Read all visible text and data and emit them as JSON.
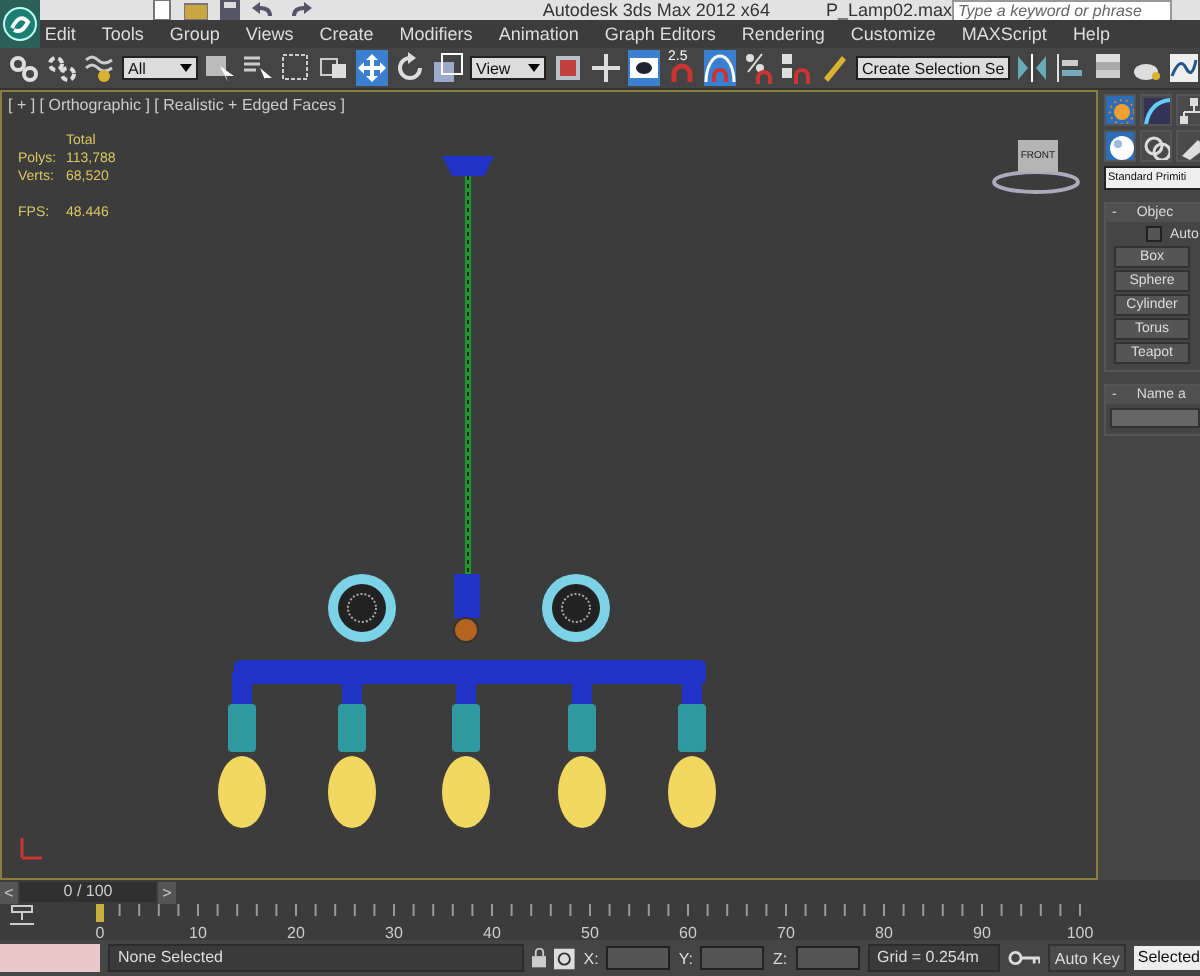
{
  "title_bar": {
    "title": "Autodesk 3ds Max  2012 x64",
    "file": "P_Lamp02.max",
    "search": {
      "placeholder": "Type a keyword or phrase"
    }
  },
  "menu": [
    "Edit",
    "Tools",
    "Group",
    "Views",
    "Create",
    "Modifiers",
    "Animation",
    "Graph Editors",
    "Rendering",
    "Customize",
    "MAXScript",
    "Help"
  ],
  "toolbar": [
    {
      "kind": "link",
      "selected": false
    },
    {
      "kind": "unlink",
      "selected": false
    },
    {
      "kind": "bind",
      "selected": false
    },
    {
      "kind": "dropdown",
      "value": "All"
    },
    {
      "kind": "select",
      "selected": false
    },
    {
      "kind": "select-name",
      "selected": false
    },
    {
      "kind": "region",
      "selected": false
    },
    {
      "kind": "window",
      "selected": false
    },
    {
      "kind": "move",
      "selected": true
    },
    {
      "kind": "rotate",
      "selected": false
    },
    {
      "kind": "scale",
      "selected": false
    },
    {
      "kind": "dropdown",
      "value": "View"
    },
    {
      "kind": "pivot",
      "selected": false
    },
    {
      "kind": "manipulate",
      "selected": false
    },
    {
      "kind": "keyboard",
      "selected": true
    },
    {
      "kind": "snap",
      "label": "2.5",
      "selected": false
    },
    {
      "kind": "angle-snap",
      "selected": true
    },
    {
      "kind": "percent-snap",
      "selected": false
    },
    {
      "kind": "spinner-snap",
      "selected": false
    },
    {
      "kind": "edit-sets",
      "selected": false
    },
    {
      "kind": "dropdown",
      "value": "Create Selection Se"
    },
    {
      "kind": "mirror",
      "selected": false
    },
    {
      "kind": "align",
      "selected": false
    },
    {
      "kind": "layers",
      "selected": false
    },
    {
      "kind": "render-setup",
      "selected": false
    },
    {
      "kind": "curve-editor",
      "selected": false
    }
  ],
  "viewport": {
    "label": "[ + ] [ Orthographic ] [ Realistic + Edged Faces ]",
    "viewcube": "FRONT",
    "stats": {
      "heading": "Total",
      "rows": [
        {
          "label": "Polys:",
          "value": "113,788"
        },
        {
          "label": "Verts:",
          "value": "68,520"
        },
        {
          "label": "FPS:",
          "value": "48.446"
        }
      ]
    }
  },
  "command_panel": {
    "tabs": [
      {
        "kind": "create",
        "selected": true
      },
      {
        "kind": "modify",
        "selected": false
      },
      {
        "kind": "hierarchy",
        "selected": false
      }
    ],
    "categories": [
      {
        "kind": "geometry",
        "selected": true
      },
      {
        "kind": "shapes",
        "selected": false
      },
      {
        "kind": "lights",
        "selected": false
      }
    ],
    "dropdown": "Standard Primiti",
    "rollouts": [
      {
        "toggle": "-",
        "title": "Objec",
        "autogrid": {
          "label": "Auto",
          "checked": false
        },
        "buttons": [
          "Box",
          "Sphere",
          "Cylinder",
          "Torus",
          "Teapot"
        ]
      },
      {
        "toggle": "-",
        "title": "Name a",
        "field": true
      }
    ]
  },
  "timeline": {
    "prev": "<",
    "position": "0 / 100",
    "next": ">",
    "ticks": [
      "0",
      "10",
      "20",
      "30",
      "40",
      "50",
      "60",
      "70",
      "80",
      "90",
      "100"
    ]
  },
  "status_bar": {
    "message": "None Selected",
    "coords": [
      "X:",
      "Y:",
      "Z:"
    ],
    "grid": "Grid = 0.254m",
    "auto_key": "Auto Key",
    "key_mode": "Selected"
  }
}
